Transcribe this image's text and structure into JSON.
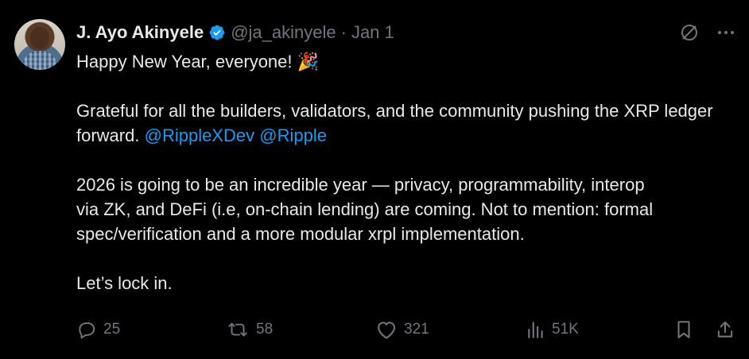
{
  "author": {
    "name": "J. Ayo Akinyele",
    "handle": "@ja_akinyele",
    "separator": "·",
    "date": "Jan 1",
    "verified": true
  },
  "tweet": {
    "line1": "Happy New Year, everyone!",
    "line1_emoji": "🎉",
    "para2_text": "Grateful for all the builders, validators, and the community pushing the XRP ledger forward.",
    "mention1": "@RippleXDev",
    "mention2": "@Ripple",
    "para3_line1": "2026 is going to be an incredible year — privacy, programmability, interop",
    "para3_line2": "via ZK, and DeFi (i.e, on-chain lending) are coming. Not to mention: formal",
    "para3_line3": "spec/verification and a more modular xrpl implementation.",
    "para4": "Let’s lock in."
  },
  "actions": {
    "replies": "25",
    "reposts": "58",
    "likes": "321",
    "views": "51K"
  },
  "colors": {
    "background": "#000000",
    "text": "#e7e9ea",
    "muted": "#71767b",
    "accent": "#1d9bf0"
  },
  "icons": {
    "verified": "verified-badge-icon",
    "grok": "slashed-circle-icon",
    "more": "more-dots-icon",
    "reply": "reply-icon",
    "repost": "repost-icon",
    "like": "heart-icon",
    "views": "views-icon",
    "bookmark": "bookmark-icon",
    "share": "share-icon"
  }
}
